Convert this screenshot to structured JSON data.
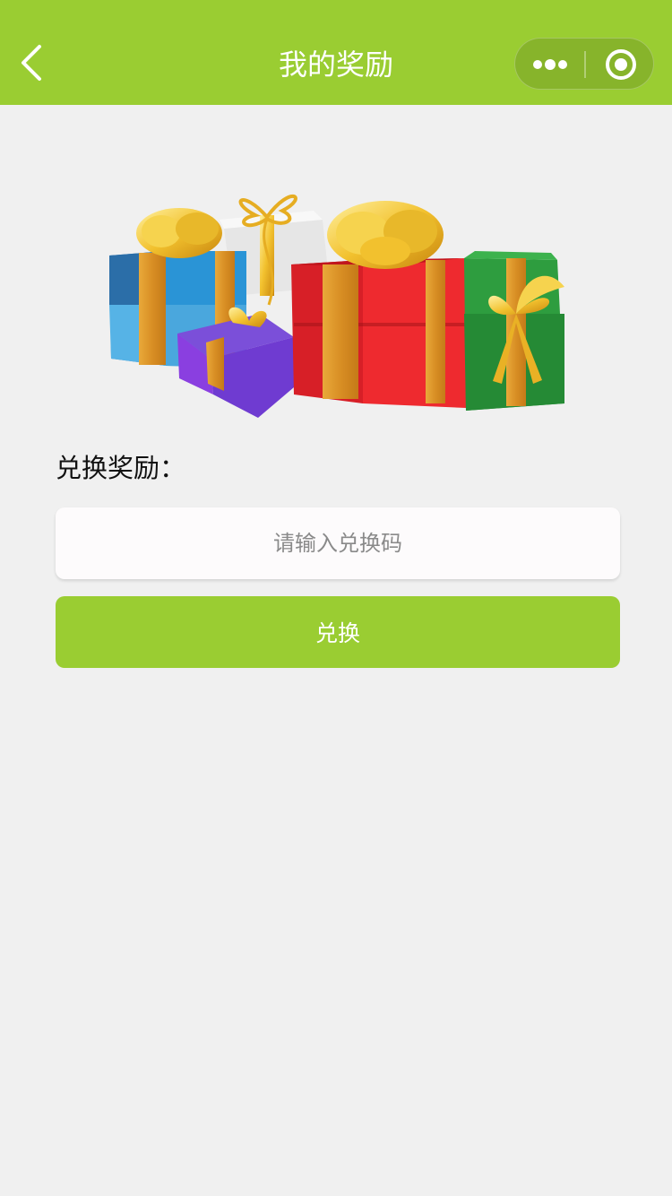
{
  "navbar": {
    "title": "我的奖励",
    "back_icon": "chevron-left-icon",
    "more_icon": "more-dots-icon",
    "close_icon": "target-circle-icon",
    "background_color": "#9acd32"
  },
  "hero": {
    "image": "gift-boxes-illustration"
  },
  "redeem": {
    "label": "兑换奖励：",
    "input_placeholder": "请输入兑换码",
    "input_value": "",
    "button_label": "兑换",
    "button_color": "#9acd32"
  }
}
